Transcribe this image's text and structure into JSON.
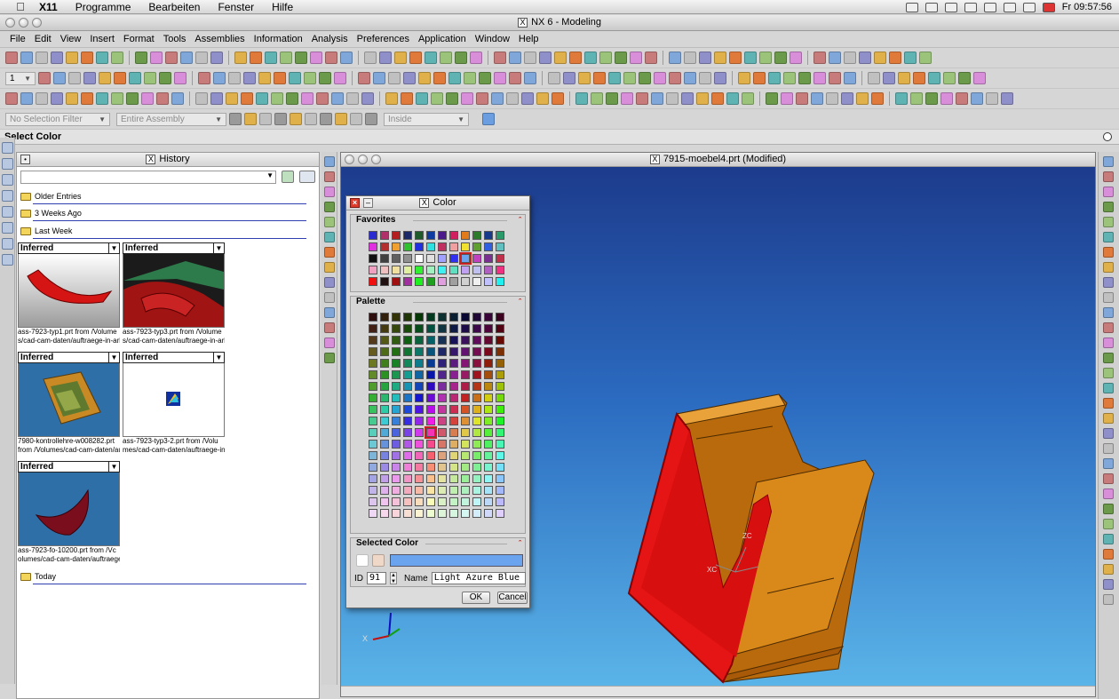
{
  "mac_menu": {
    "app": "X11",
    "items": [
      "Programme",
      "Bearbeiten",
      "Fenster",
      "Hilfe"
    ],
    "clock": "Fr 09:57:56"
  },
  "window": {
    "title": "NX 6 - Modeling"
  },
  "menubar": [
    "File",
    "Edit",
    "View",
    "Insert",
    "Format",
    "Tools",
    "Assemblies",
    "Information",
    "Analysis",
    "Preferences",
    "Application",
    "Window",
    "Help"
  ],
  "toolbar": {
    "layer_value": "1",
    "selection_filter": "No Selection Filter",
    "assembly_scope": "Entire Assembly",
    "inside": "Inside"
  },
  "status_prompt": "Select Color",
  "history": {
    "title": "History",
    "groups": [
      "Older Entries",
      "3 Weeks Ago",
      "Last Week",
      "Today"
    ],
    "thumbs": [
      {
        "mode": "Inferred",
        "line1": "ass-7923-typ1.prt from /Volume",
        "line2": "s/cad-cam-daten/auftraege-in-arl"
      },
      {
        "mode": "Inferred",
        "line1": "ass-7923-typ3.prt from /Volume",
        "line2": "s/cad-cam-daten/auftraege-in-arl"
      },
      {
        "mode": "Inferred",
        "line1": "7980-kontrollehre-w008282.prt",
        "line2": " from /Volumes/cad-cam-daten/au"
      },
      {
        "mode": "Inferred",
        "line1": "ass-7923-typ3-2.prt from /Volu",
        "line2": "mes/cad-cam-daten/auftraege-in-"
      },
      {
        "mode": "Inferred",
        "line1": "ass-7923-fo-10200.prt from /Vc",
        "line2": "olumes/cad-cam-daten/auftraege-"
      }
    ]
  },
  "graphics": {
    "title": "7915-moebel4.prt (Modified)",
    "axis_labels": {
      "zc": "ZC",
      "xc": "XC",
      "x": "X"
    }
  },
  "color_dialog": {
    "title": "Color",
    "favorites_label": "Favorites",
    "palette_label": "Palette",
    "selected_label": "Selected Color",
    "id_label": "ID",
    "id_value": "91",
    "name_label": "Name",
    "name_value": "Light Azure Blue",
    "ok_label": "OK",
    "cancel_label": "Cancel",
    "selected_hex": "#6aa3ee"
  },
  "colors": {
    "viewport_top": "#1d3b8c",
    "viewport_bottom": "#5ab4e8",
    "part_body": "#d9881a",
    "part_highlight": "#e51515"
  }
}
